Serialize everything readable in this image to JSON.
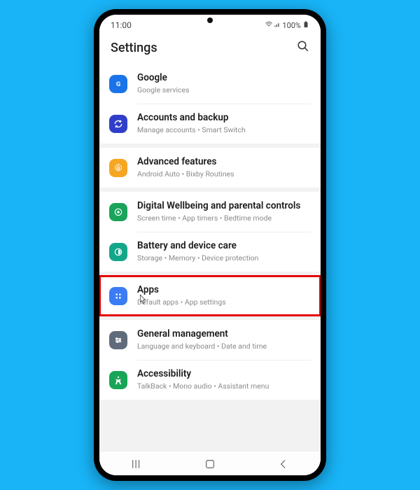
{
  "status": {
    "time": "11:00",
    "battery": "100%"
  },
  "header": {
    "title": "Settings"
  },
  "colors": {
    "google": "#1a73e8",
    "accounts": "#2f3ec9",
    "advanced": "#f5a623",
    "wellbeing": "#1aa35a",
    "battery": "#13a789",
    "apps": "#3b7cf5",
    "general": "#5f6b7a",
    "accessibility": "#18a558",
    "highlight": "#e60000"
  },
  "items": [
    {
      "id": "google",
      "icon": "google-icon",
      "title": "Google",
      "subtitle": "Google services",
      "group": 0
    },
    {
      "id": "accounts",
      "icon": "sync-icon",
      "title": "Accounts and backup",
      "subtitle": "Manage accounts • Smart Switch",
      "group": 0
    },
    {
      "id": "advanced",
      "icon": "gear-icon",
      "title": "Advanced features",
      "subtitle": "Android Auto • Bixby Routines",
      "group": 1
    },
    {
      "id": "wellbeing",
      "icon": "wellbeing-icon",
      "title": "Digital Wellbeing and parental controls",
      "subtitle": "Screen time • App timers • Bedtime mode",
      "group": 2
    },
    {
      "id": "battery",
      "icon": "battery-icon",
      "title": "Battery and device care",
      "subtitle": "Storage • Memory • Device protection",
      "group": 2
    },
    {
      "id": "apps",
      "icon": "apps-icon",
      "title": "Apps",
      "subtitle": "Default apps • App settings",
      "group": 3,
      "highlighted": true,
      "cursor": true
    },
    {
      "id": "general",
      "icon": "general-icon",
      "title": "General management",
      "subtitle": "Language and keyboard • Date and time",
      "group": 4
    },
    {
      "id": "accessibility",
      "icon": "accessibility-icon",
      "title": "Accessibility",
      "subtitle": "TalkBack • Mono audio • Assistant menu",
      "group": 4
    }
  ]
}
